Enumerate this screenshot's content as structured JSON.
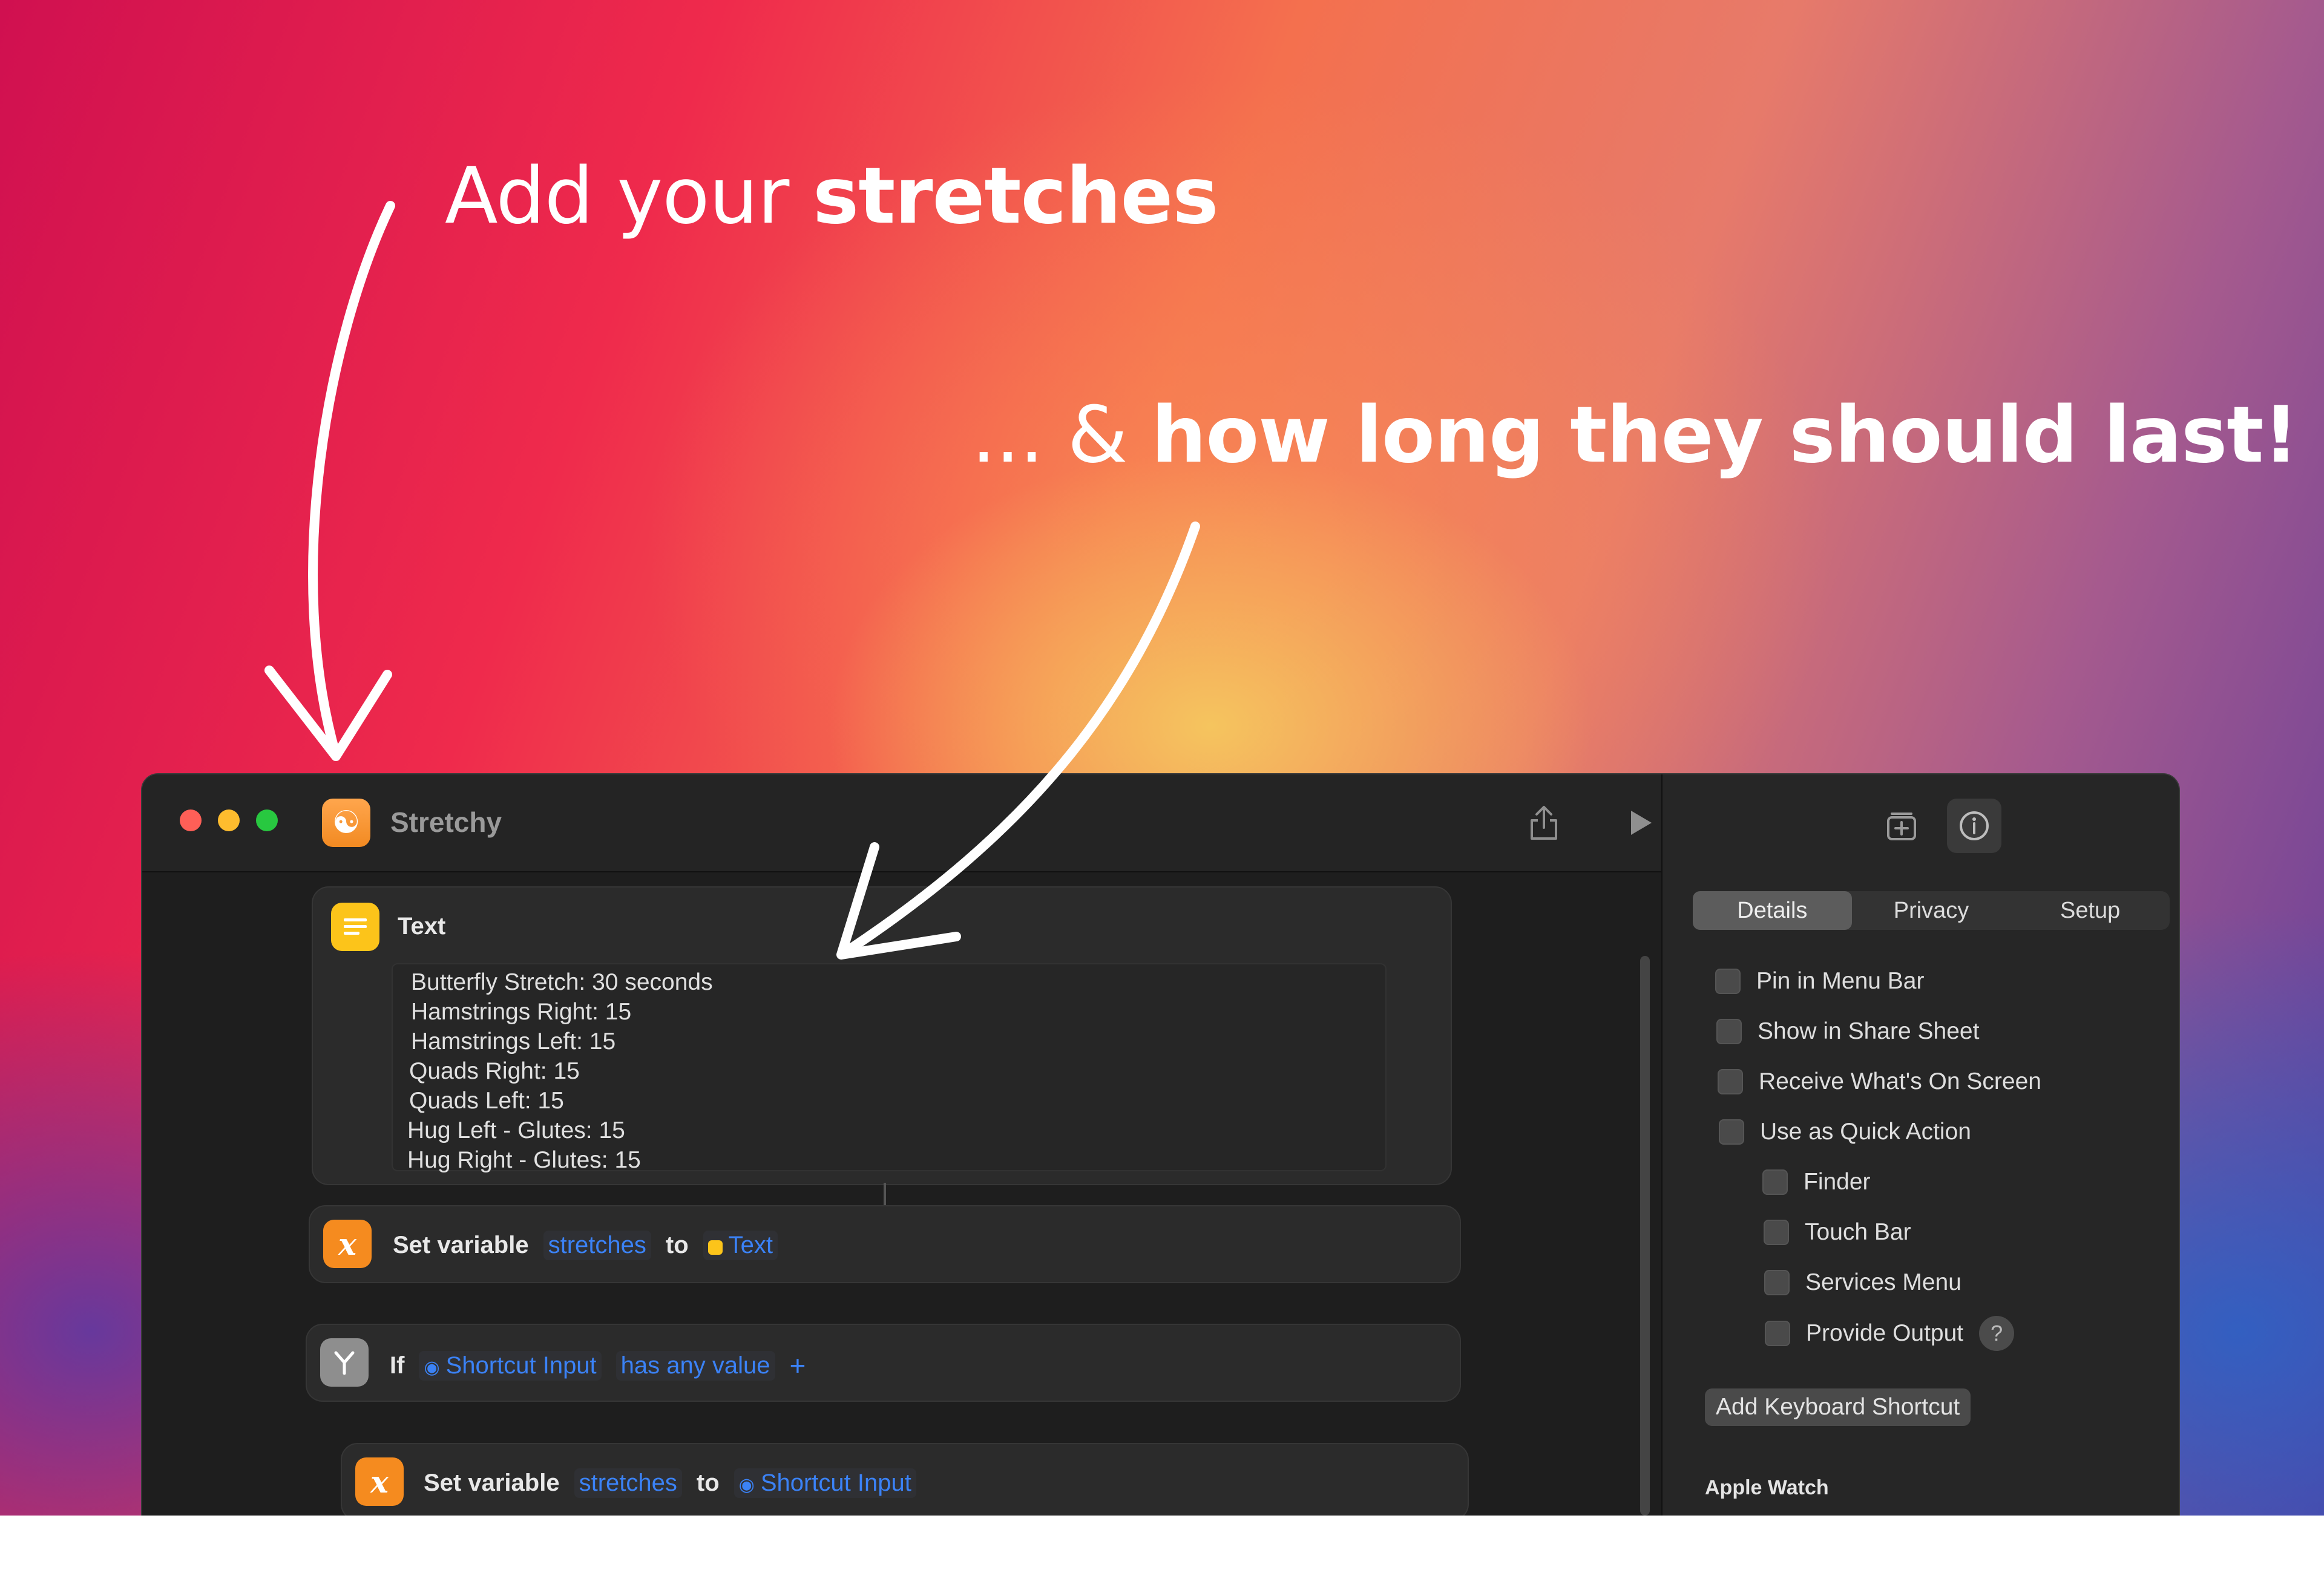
{
  "headline1": {
    "pre": "Add your ",
    "bold": "stretches"
  },
  "headline2": {
    "pre": "... & ",
    "bold": "how long they should last!"
  },
  "window": {
    "title": "Stretchy"
  },
  "text_action": {
    "title": "Text",
    "lines": [
      "Butterfly Stretch: 30 seconds",
      "Hamstrings Right: 15",
      "Hamstrings Left: 15",
      "Quads Right: 15",
      "Quads Left: 15",
      "Hug Left - Glutes: 15",
      "Hug Right - Glutes: 15"
    ]
  },
  "set_var_1": {
    "label": "Set variable",
    "variable": "stretches",
    "to": "to",
    "value": "Text"
  },
  "if_action": {
    "label": "If",
    "input": "Shortcut Input",
    "condition": "has any value",
    "add": "+"
  },
  "set_var_2": {
    "label": "Set variable",
    "variable": "stretches",
    "to": "to",
    "value": "Shortcut Input"
  },
  "sidebar": {
    "tabs": [
      "Details",
      "Privacy",
      "Setup"
    ],
    "options": [
      "Pin in Menu Bar",
      "Show in Share Sheet",
      "Receive What's On Screen",
      "Use as Quick Action",
      "Finder",
      "Touch Bar",
      "Services Menu",
      "Provide Output"
    ],
    "help": "?",
    "keyboard_button": "Add Keyboard Shortcut",
    "section": "Apple Watch"
  }
}
